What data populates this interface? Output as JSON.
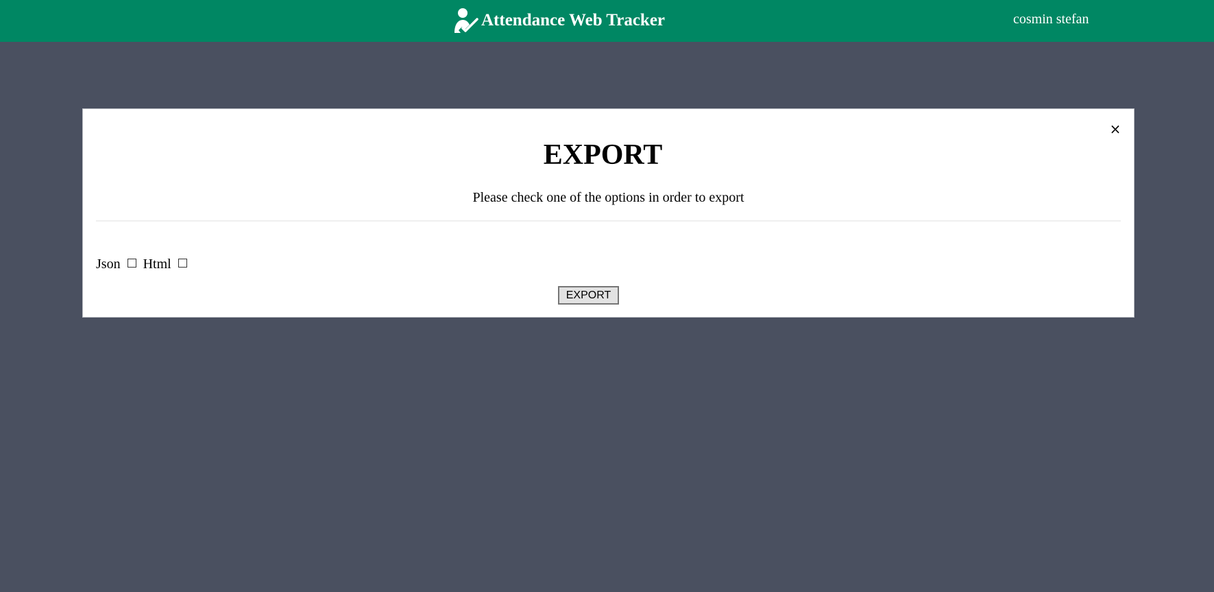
{
  "header": {
    "title": "Attendance Web Tracker",
    "logo_icon": "user-check-icon",
    "user_name": "cosmin stefan",
    "background_color": "#008763"
  },
  "modal": {
    "title": "EXPORT",
    "subtitle": "Please check one of the options in order to export",
    "close_icon": "close-icon",
    "close_label": "×",
    "options": [
      {
        "label": "Json",
        "checked": false
      },
      {
        "label": "Html",
        "checked": false
      }
    ],
    "export_button_label": "EXPORT"
  },
  "colors": {
    "page_background": "#4a5060",
    "modal_background": "#ffffff"
  }
}
